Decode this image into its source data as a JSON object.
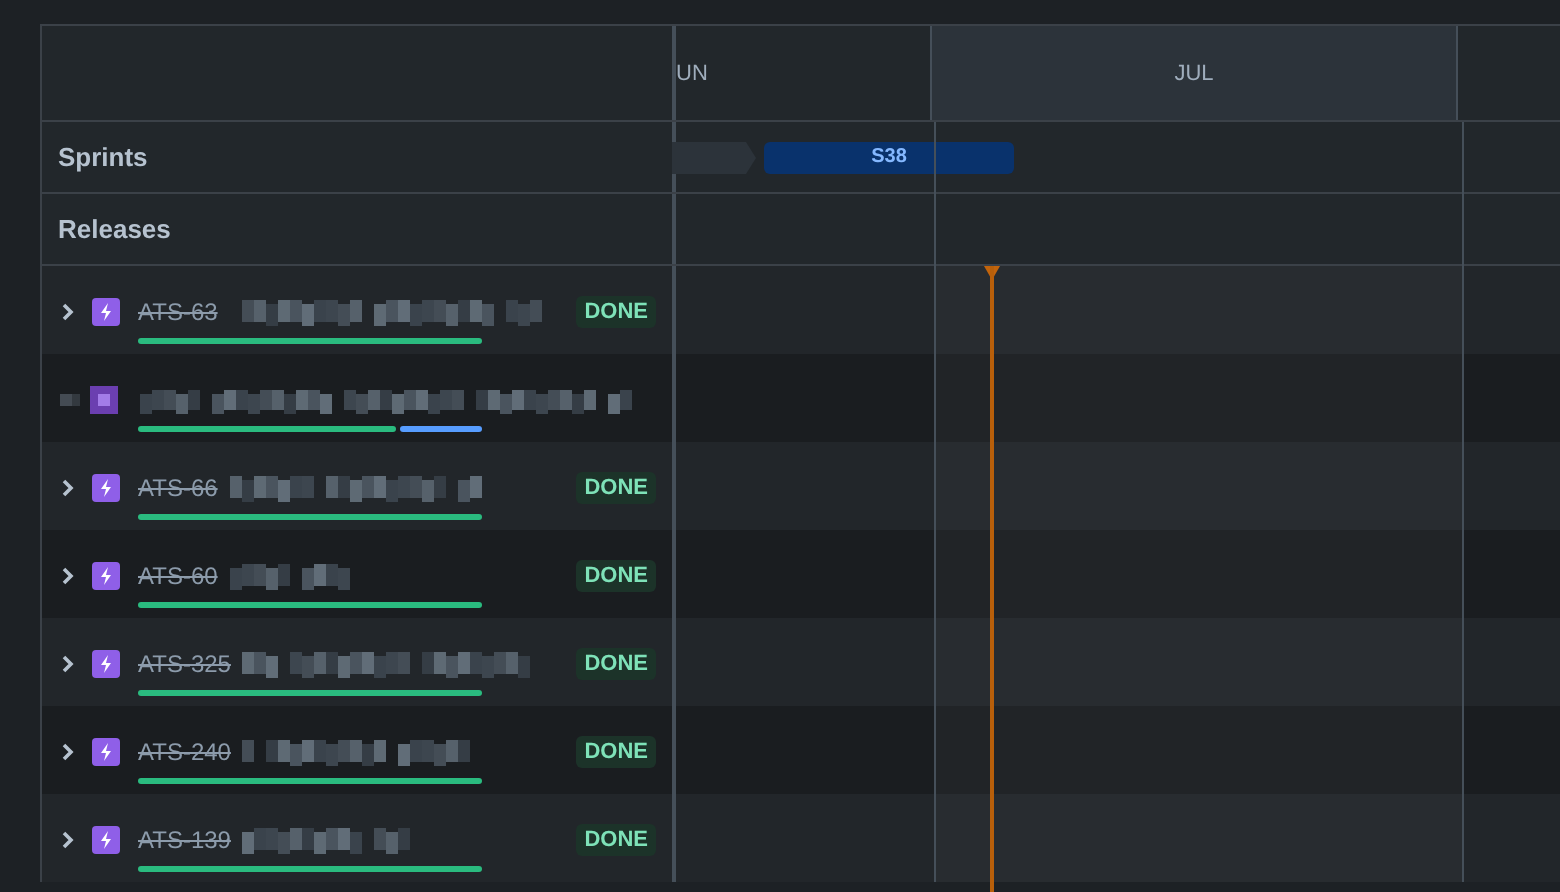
{
  "timeline": {
    "months": [
      {
        "label": "UN",
        "kind": "partial"
      },
      {
        "label": "JUL",
        "kind": "current"
      },
      {
        "kind": "next"
      }
    ]
  },
  "sprints": {
    "label": "Sprints",
    "bars": [
      {
        "kind": "past"
      },
      {
        "kind": "active",
        "label": "S38"
      }
    ]
  },
  "releases": {
    "label": "Releases"
  },
  "issues": [
    {
      "kind": "epic",
      "key": "ATS-63",
      "status": "DONE",
      "level": 1
    },
    {
      "kind": "blurred",
      "level": 0.75
    },
    {
      "kind": "epic",
      "key": "ATS-66",
      "status": "DONE",
      "level": 1
    },
    {
      "kind": "epic",
      "key": "ATS-60",
      "status": "DONE",
      "level": 1
    },
    {
      "kind": "epic",
      "key": "ATS-325",
      "status": "DONE",
      "level": 1
    },
    {
      "kind": "epic",
      "key": "ATS-240",
      "status": "DONE",
      "level": 1
    },
    {
      "kind": "epic",
      "key": "ATS-139",
      "status": "DONE",
      "level": 1
    }
  ]
}
